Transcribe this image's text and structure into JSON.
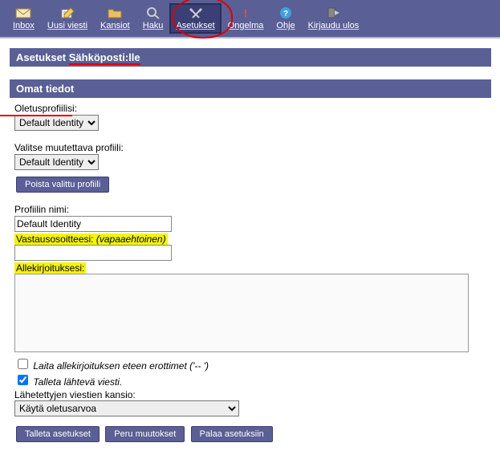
{
  "toolbar": {
    "items": [
      {
        "label": "Inbox",
        "icon": "inbox-icon"
      },
      {
        "label": "Uusi viesti",
        "icon": "compose-icon"
      },
      {
        "label": "Kansiot",
        "icon": "folders-icon"
      },
      {
        "label": "Haku",
        "icon": "search-icon"
      },
      {
        "label": "Asetukset",
        "icon": "tools-icon",
        "active": true
      },
      {
        "label": "Ongelma",
        "icon": "problem-icon"
      },
      {
        "label": "Ohje",
        "icon": "help-icon"
      },
      {
        "label": "Kirjaudu ulos",
        "icon": "logout-icon"
      }
    ]
  },
  "headers": {
    "page_title_prefix": "Asetukset ",
    "page_title_highlighted": "Sähköposti:lle",
    "section_title": "Omat tiedot"
  },
  "form": {
    "default_profile_label": "Oletusprofiilisi:",
    "default_profile_value": "Default Identity",
    "select_profile_label": "Valitse muutettava profiili:",
    "select_profile_value": "Default Identity",
    "delete_button": "Poista valittu profiili",
    "profile_name_label": "Profiilin nimi:",
    "profile_name_value": "Default Identity",
    "reply_address_label": "Vastausosoitteesi: ",
    "reply_address_optional": "(vapaaehtoinen)",
    "reply_address_value": "",
    "signature_label": "Allekirjoituksesi:",
    "signature_value": "",
    "sep_checkbox_label": "Laita allekirjoituksen eteen erottimet ('-- ')",
    "sep_checked": false,
    "save_sent_label": "Talleta lähtevä viesti.",
    "save_sent_checked": true,
    "sent_folder_label": "Lähetettyjen viestien kansio:",
    "sent_folder_value": "Käytä oletusarvoa"
  },
  "buttons": {
    "save": "Talleta asetukset",
    "undo": "Peru muutokset",
    "back": "Palaa asetuksiin"
  }
}
